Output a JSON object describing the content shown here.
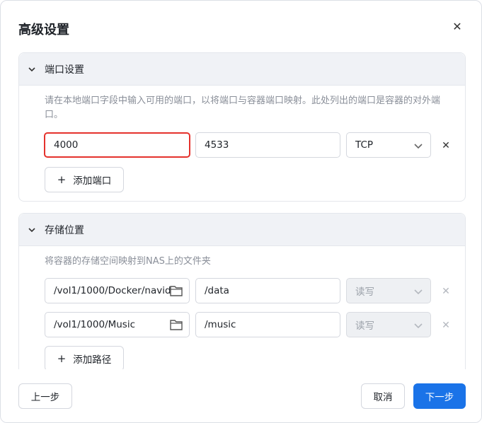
{
  "dialog": {
    "title": "高级设置",
    "close_icon": "close-icon"
  },
  "ports_section": {
    "title": "端口设置",
    "description": "请在本地端口字段中输入可用的端口，以将端口与容器端口映射。此处列出的端口是容器的对外端口。",
    "rows": [
      {
        "local_port": "4000",
        "container_port": "4533",
        "protocol": "TCP"
      }
    ],
    "add_label": "添加端口"
  },
  "storage_section": {
    "title": "存储位置",
    "description": "将容器的存储空间映射到NAS上的文件夹",
    "rows": [
      {
        "nas_path": "/vol1/1000/Docker/navid",
        "container_path": "/data",
        "permission": "读写"
      },
      {
        "nas_path": "/vol1/1000/Music",
        "container_path": "/music",
        "permission": "读写"
      }
    ],
    "add_label": "添加路径"
  },
  "footer": {
    "prev_label": "上一步",
    "cancel_label": "取消",
    "next_label": "下一步"
  },
  "colors": {
    "primary": "#1a73e8",
    "highlight_border": "#e5322d"
  }
}
